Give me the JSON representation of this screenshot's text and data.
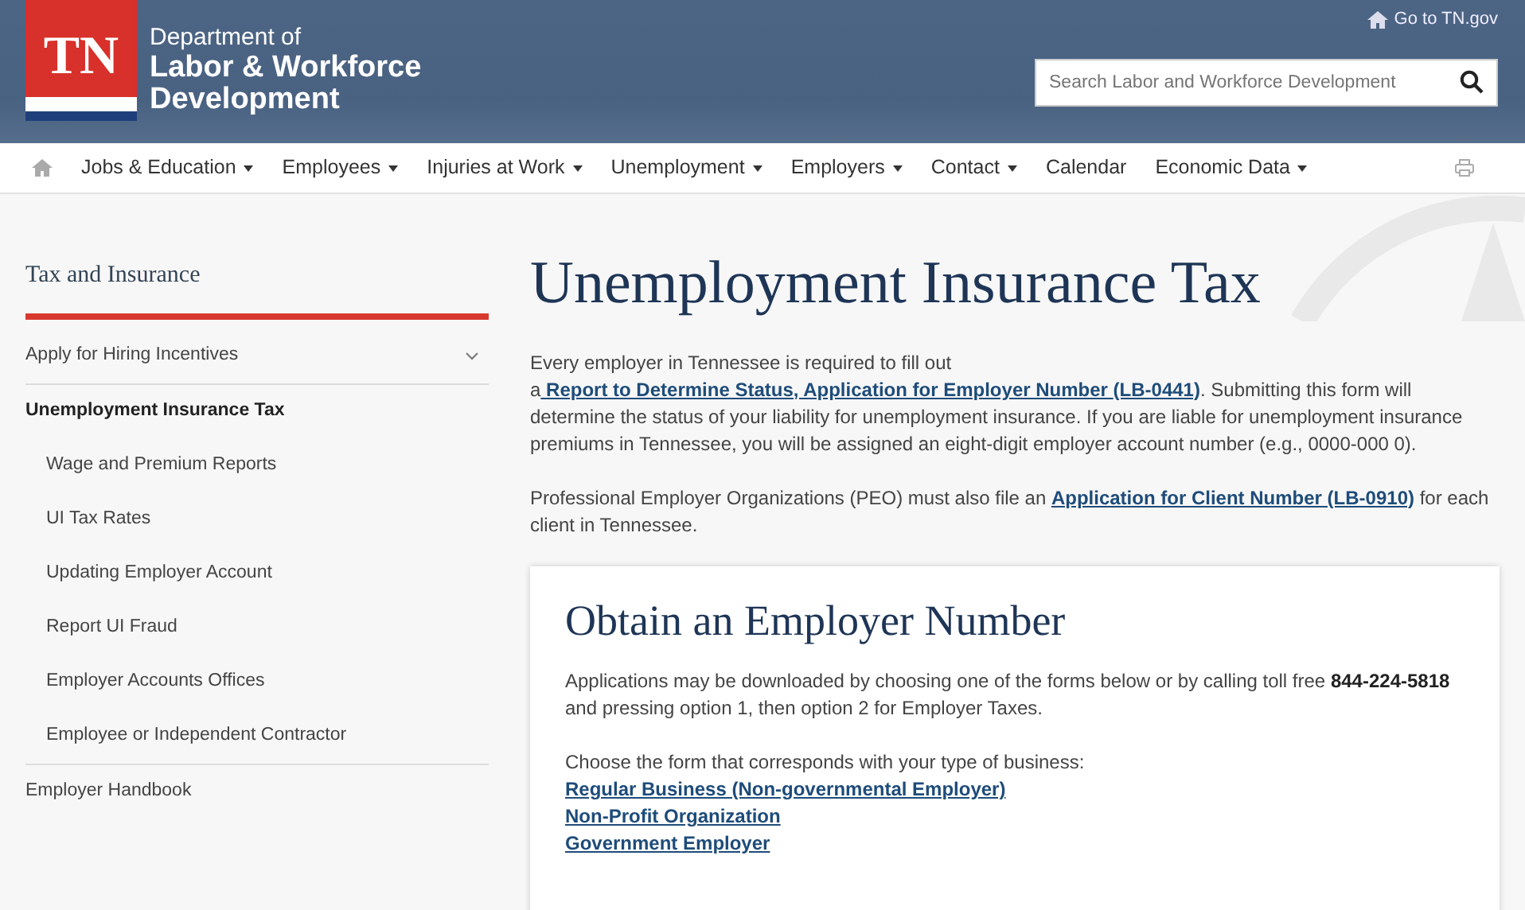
{
  "header": {
    "logo_text": "TN",
    "agency_line1": "Department of",
    "agency_line2": "Labor & Workforce",
    "agency_line3": "Development",
    "top_link": "Go to TN.gov",
    "search": {
      "placeholder": "Search Labor and Workforce Development"
    }
  },
  "nav": [
    {
      "label": "Jobs & Education",
      "dropdown": true
    },
    {
      "label": "Employees",
      "dropdown": true
    },
    {
      "label": "Injuries at Work",
      "dropdown": true
    },
    {
      "label": "Unemployment",
      "dropdown": true
    },
    {
      "label": "Employers",
      "dropdown": true
    },
    {
      "label": "Contact",
      "dropdown": true
    },
    {
      "label": "Calendar",
      "dropdown": false
    },
    {
      "label": "Economic Data",
      "dropdown": true
    }
  ],
  "sidebar": {
    "title": "Tax and Insurance",
    "items": [
      {
        "label": "Apply for Hiring Incentives",
        "selected": false,
        "kind": "collapsible"
      },
      {
        "label": "Unemployment Insurance Tax",
        "selected": true,
        "kind": "plain",
        "children": [
          {
            "label": "Wage and Premium Reports"
          },
          {
            "label": "UI Tax Rates"
          },
          {
            "label": "Updating Employer Account"
          },
          {
            "label": "Report UI Fraud"
          },
          {
            "label": "Employer Accounts Offices"
          },
          {
            "label": "Employee or Independent Contractor"
          }
        ]
      },
      {
        "label": "Employer Handbook",
        "selected": false,
        "kind": "plain"
      }
    ]
  },
  "main": {
    "title": "Unemployment Insurance Tax",
    "paragraphs": [
      [
        {
          "kind": "text",
          "text": "Every employer in Tennessee is required to fill out a"
        },
        {
          "kind": "link",
          "text": " Report to Determine Status, Application for Employer Number "
        },
        {
          "kind": "link",
          "text": "(LB-0441)"
        },
        {
          "kind": "text",
          "text": ". Submitting this form will determine the status of your liability for unemployment insurance. If you are liable for unemployment insurance premiums in Tennessee, you will be assigned an eight-digit employer account number (e.g., 0000-000 0)."
        }
      ],
      [
        {
          "kind": "text",
          "text": "Professional Employer Organizations (PEO) must also file an "
        },
        {
          "kind": "link",
          "text": "Application for Client Number (LB-0910)"
        },
        {
          "kind": "text",
          "text": " for each client in Tennessee."
        }
      ]
    ],
    "card": {
      "title": "Obtain an Employer Number",
      "paragraphs": [
        [
          {
            "kind": "text",
            "text": "Applications may be downloaded by choosing one of the forms below or by calling toll free "
          },
          {
            "kind": "bold",
            "text": "844-224-5818"
          },
          {
            "kind": "text",
            "text": " and pressing  option 1, then option 2 for Employer Taxes."
          }
        ]
      ],
      "choose_text": "Choose the form that corresponds with your type of business:",
      "links": [
        "Regular Business (Non-governmental Employer)",
        "Non-Profit Organization",
        "Government Employer"
      ]
    }
  }
}
